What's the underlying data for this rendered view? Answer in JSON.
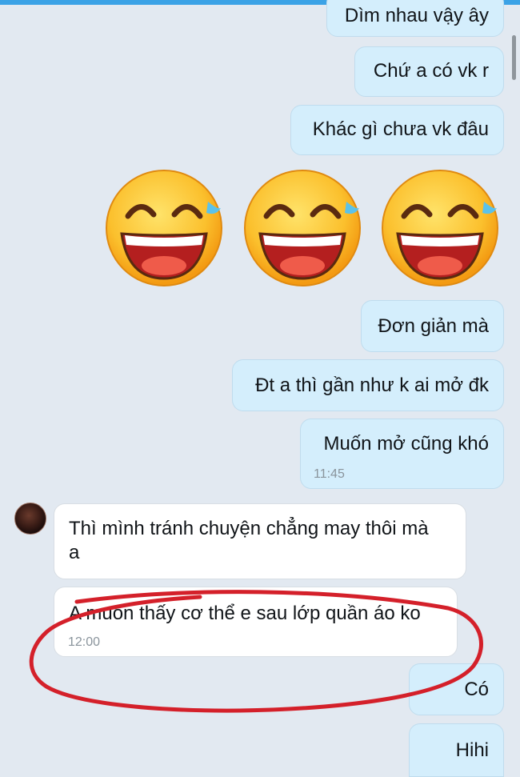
{
  "chat": {
    "messages": [
      {
        "text": "Dìm nhau vậy ây"
      },
      {
        "text": "Chứ a có vk r"
      },
      {
        "text": "Khác gì chưa vk đâu"
      },
      {
        "text": "Đơn giản mà"
      },
      {
        "text": "Đt a thì gần như k ai mở đk"
      },
      {
        "text": "Muốn mở cũng khó",
        "time": "11:45"
      },
      {
        "line1": "Thì mình tránh chuyện chẳng may thôi mà",
        "line2": "a"
      },
      {
        "text": "A muốn thấy cơ thể e sau lớp quần áo ko",
        "time": "12:00"
      },
      {
        "text": "Có"
      },
      {
        "text": "Hihi"
      }
    ],
    "emojis": [
      "laughing-tears-emoji",
      "laughing-tears-emoji",
      "laughing-tears-emoji"
    ]
  },
  "colors": {
    "background": "#e2e9f1",
    "sent_bubble": "#d4eefc",
    "received_bubble": "#ffffff",
    "annotation": "#d4202a",
    "top_accent": "#3ba2e6"
  }
}
